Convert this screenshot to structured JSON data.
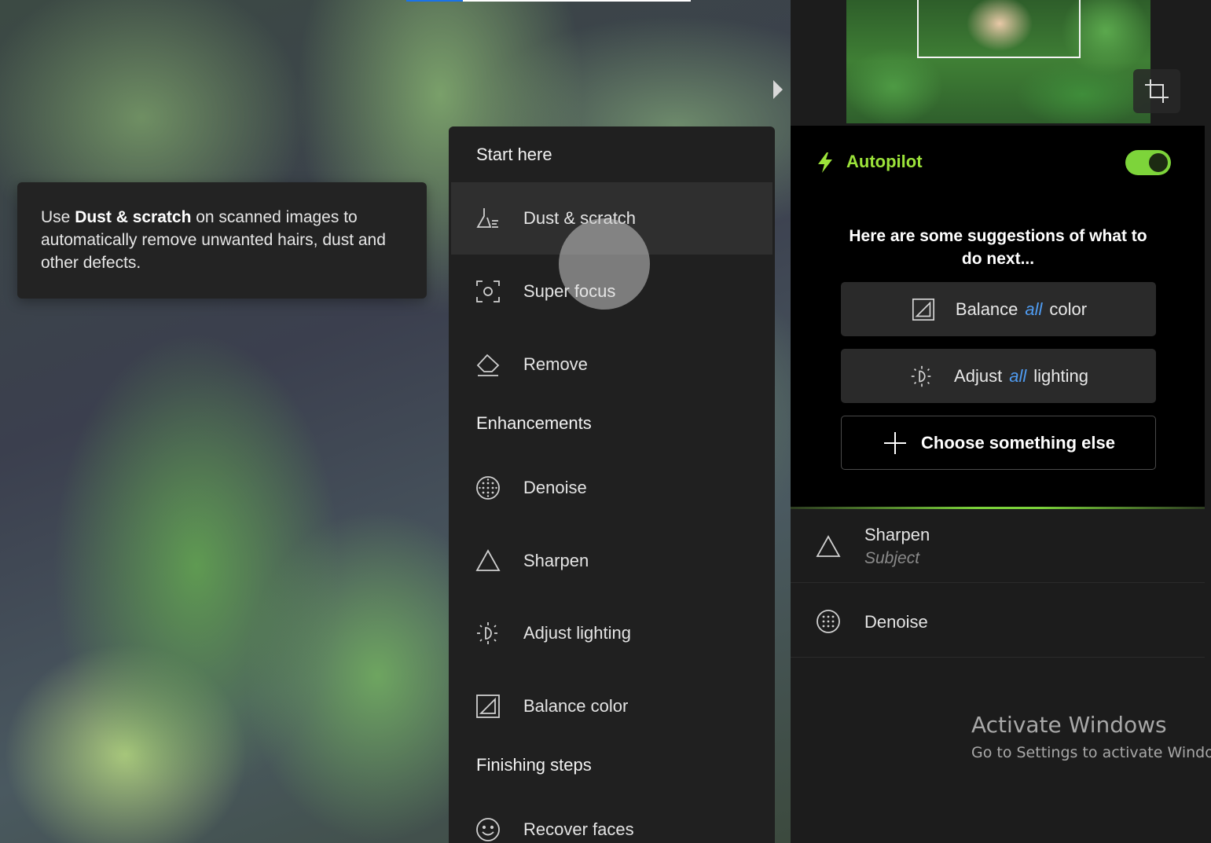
{
  "tooltip": {
    "prefix": "Use ",
    "bold": "Dust & scratch",
    "suffix": " on scanned images to automatically remove unwanted hairs, dust and other defects."
  },
  "menu": {
    "sections": [
      {
        "heading": "Start here"
      },
      {
        "heading": "Enhancements"
      },
      {
        "heading": "Finishing steps"
      }
    ],
    "items": [
      {
        "label": "Dust & scratch",
        "icon": "broom-icon",
        "active": true
      },
      {
        "label": "Super focus",
        "icon": "focus-frame-icon"
      },
      {
        "label": "Remove",
        "icon": "eraser-icon"
      },
      {
        "label": "Denoise",
        "icon": "dotted-circle-icon"
      },
      {
        "label": "Sharpen",
        "icon": "triangle-icon"
      },
      {
        "label": "Adjust lighting",
        "icon": "lightbulb-icon"
      },
      {
        "label": "Balance color",
        "icon": "contrast-square-icon"
      },
      {
        "label": "Recover faces",
        "icon": "smiley-icon"
      }
    ]
  },
  "autopilot": {
    "title": "Autopilot",
    "enabled": true,
    "suggestion_text": "Here are some suggestions of what to do next...",
    "buttons": [
      {
        "pre": "Balance",
        "em": "all",
        "post": "color",
        "icon": "contrast-square-icon"
      },
      {
        "pre": "Adjust",
        "em": "all",
        "post": "lighting",
        "icon": "lightbulb-icon"
      }
    ],
    "choose_label": "Choose something else"
  },
  "applied": [
    {
      "title": "Sharpen",
      "subtitle": "Subject",
      "icon": "triangle-icon"
    },
    {
      "title": "Denoise",
      "icon": "dotted-circle-icon"
    }
  ],
  "watermark": {
    "title": "Activate Windows",
    "subtitle": "Go to Settings to activate Windows."
  },
  "colors": {
    "accent_green": "#7dd43a",
    "accent_blue": "#4f9bf0",
    "panel_bg": "#202020"
  }
}
